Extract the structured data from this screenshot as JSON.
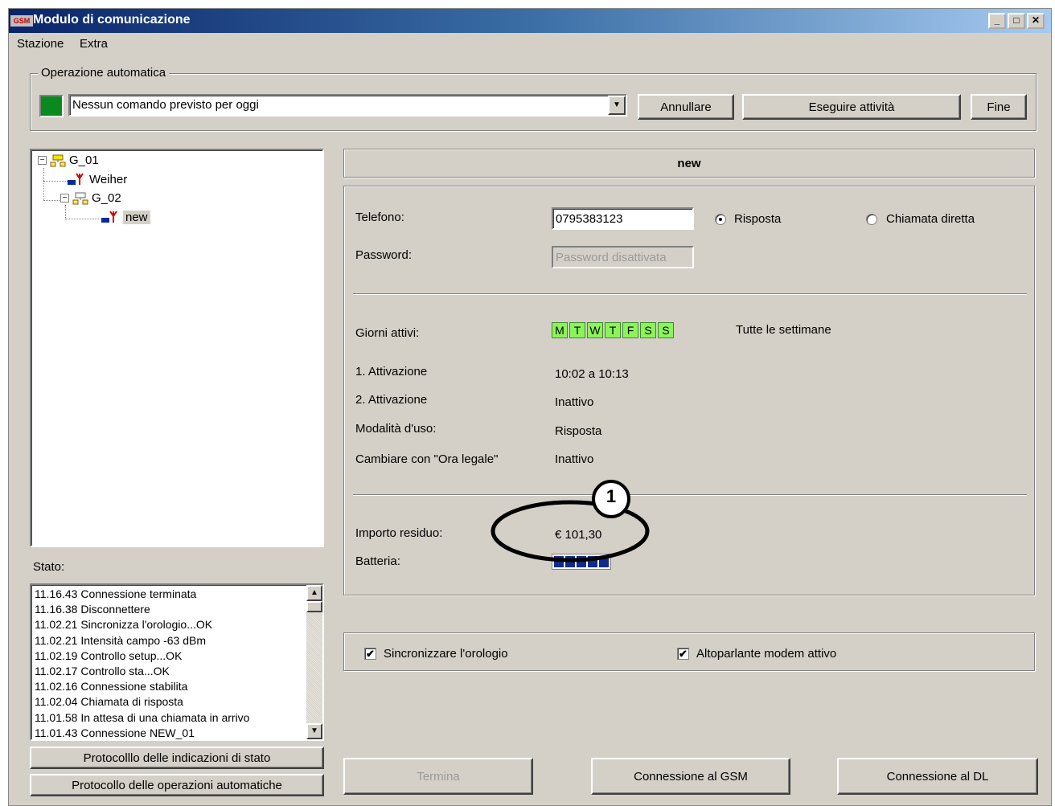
{
  "window": {
    "title": "Modulo di comunicazione",
    "app_badge": "GSM",
    "controls": [
      "_",
      "□",
      "✕"
    ]
  },
  "menu": {
    "items": [
      "Stazione",
      "Extra"
    ]
  },
  "auto_op": {
    "group_label": "Operazione automatica",
    "indicator_color": "#0a8a1e",
    "combo_value": "Nessun comando previsto per oggi",
    "cancel_label": "Annullare",
    "run_label": "Eseguire attività",
    "end_label": "Fine"
  },
  "tree": {
    "nodes": [
      {
        "label": "G_01",
        "icon": "network-group-icon"
      },
      {
        "label": "Weiher",
        "icon": "antenna-station-icon"
      },
      {
        "label": "G_02",
        "icon": "network-group-icon"
      },
      {
        "label": "new",
        "icon": "antenna-station-icon",
        "selected": true
      }
    ]
  },
  "status": {
    "label": "Stato:",
    "lines": [
      "11.16.43 Connessione terminata",
      "11.16.38 Disconnettere",
      "11.02.21 Sincronizza l'orologio...OK",
      "11.02.21 Intensità campo -63 dBm",
      "11.02.19 Controllo setup...OK",
      "11.02.17 Controllo sta...OK",
      "11.02.16 Connessione stabilita",
      "11.02.04 Chiamata di risposta",
      "11.01.58 In attesa di una chiamata in arrivo",
      "11.01.43 Connessione NEW_01"
    ],
    "log_button": "Protocolllo delle indicazioni di stato",
    "auto_log_button": "Protocollo delle operazioni automatiche"
  },
  "detail": {
    "station_name": "new",
    "phone_label": "Telefono:",
    "phone_value": "0795383123",
    "radio_answer": "Risposta",
    "radio_direct": "Chiamata diretta",
    "password_label": "Password:",
    "password_placeholder": "Password disattivata",
    "days_label": "Giorni attivi:",
    "days": [
      "M",
      "T",
      "W",
      "T",
      "F",
      "S",
      "S"
    ],
    "weeks_text": "Tutte le settimane",
    "act1_label": "1. Attivazione",
    "act1_value": "10:02 a 10:13",
    "act2_label": "2. Attivazione",
    "act2_value": "Inattivo",
    "mode_label": "Modalità d'uso:",
    "mode_value": "Risposta",
    "dst_label": "Cambiare con \"Ora legale\"",
    "dst_value": "Inattivo",
    "credit_label": "Importo residuo:",
    "credit_value": "€ 101,30",
    "battery_label": "Batteria:",
    "battery_level": 5,
    "callout_number": "1"
  },
  "options": {
    "sync_clock": "Sincronizzare l'orologio",
    "speaker": "Altoparlante modem attivo"
  },
  "bottom_buttons": {
    "terminate": "Termina",
    "gsm": "Connessione al GSM",
    "dl": "Connessione al DL"
  }
}
